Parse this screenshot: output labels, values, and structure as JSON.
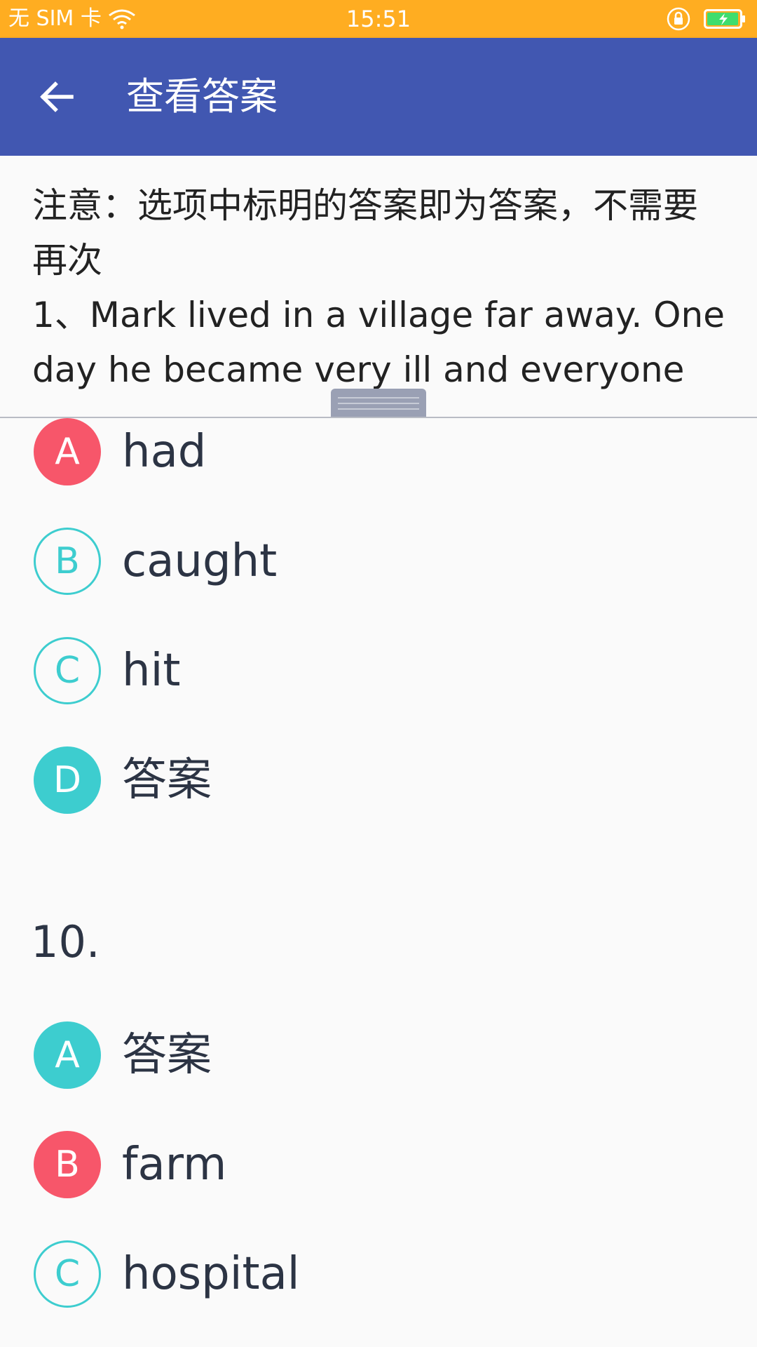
{
  "status_bar": {
    "carrier": "无 SIM 卡",
    "time": "15:51",
    "background": "#ffad21"
  },
  "app_bar": {
    "title": "查看答案",
    "background": "#4157b1"
  },
  "notice": {
    "text": "注意：选项中标明的答案即为答案，不需要再次",
    "question_line1": "1、Mark lived in a village far away. One",
    "question_line2": "day he became very ill and everyone"
  },
  "question_9": {
    "options": [
      {
        "letter": "A",
        "text": "had",
        "state": "wrong"
      },
      {
        "letter": "B",
        "text": "caught",
        "state": "neutral"
      },
      {
        "letter": "C",
        "text": "hit",
        "state": "neutral"
      },
      {
        "letter": "D",
        "text": "答案",
        "state": "correct"
      }
    ]
  },
  "question_10": {
    "number": "10.",
    "options": [
      {
        "letter": "A",
        "text": "答案",
        "state": "correct"
      },
      {
        "letter": "B",
        "text": "farm",
        "state": "wrong"
      },
      {
        "letter": "C",
        "text": "hospital",
        "state": "neutral"
      }
    ]
  },
  "colors": {
    "wrong": "#f7566a",
    "correct": "#3dcdcf",
    "text": "#2c3444"
  }
}
